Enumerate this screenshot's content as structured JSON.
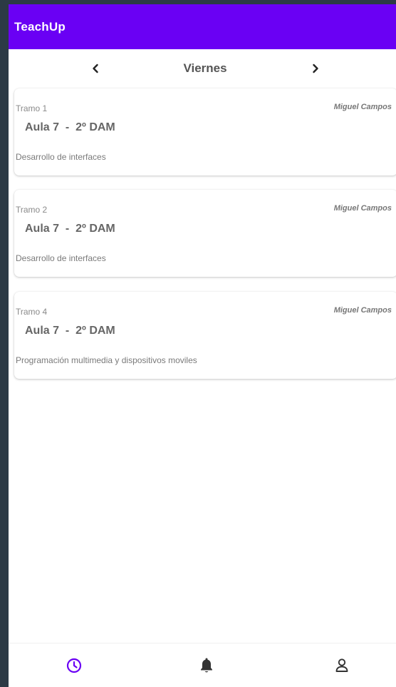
{
  "app": {
    "title": "TeachUp"
  },
  "day_nav": {
    "day": "Viernes",
    "prev_icon": "chevron-left-icon",
    "next_icon": "chevron-right-icon"
  },
  "cards": [
    {
      "slot": "Tramo  1",
      "teacher": "Miguel Campos",
      "room": "Aula 7  -  2º DAM",
      "subject": "Desarrollo de interfaces"
    },
    {
      "slot": "Tramo  2",
      "teacher": "Miguel Campos",
      "room": "Aula 7  -  2º DAM",
      "subject": "Desarrollo de interfaces"
    },
    {
      "slot": "Tramo  4",
      "teacher": "Miguel Campos",
      "room": "Aula 7  -  2º DAM",
      "subject": "Programación multimedia y dispositivos moviles"
    }
  ],
  "bottom_nav": {
    "items": [
      {
        "icon": "clock-icon",
        "active": true
      },
      {
        "icon": "bell-icon",
        "active": false
      },
      {
        "icon": "user-icon",
        "active": false
      }
    ]
  },
  "colors": {
    "primary": "#6a00f4",
    "background_frame": "#2c3a45",
    "active_icon": "#6a00f4",
    "inactive_icon": "#333333"
  }
}
